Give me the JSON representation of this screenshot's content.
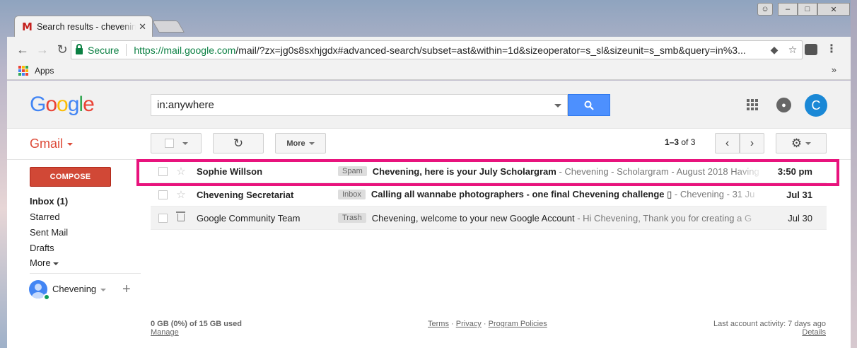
{
  "browser": {
    "tab_title": "Search results - chevening",
    "secure_label": "Secure",
    "url_domain": "https://mail.google.com",
    "url_rest": "/mail/?zx=jg0s8sxhjgdx#advanced-search/subset=ast&within=1d&sizeoperator=s_sl&sizeunit=s_smb&query=in%3...",
    "bookmarks": {
      "apps_label": "Apps",
      "more_glyph": "»"
    }
  },
  "header": {
    "logo_letters": [
      "G",
      "o",
      "o",
      "g",
      "l",
      "e"
    ],
    "search_value": "in:anywhere",
    "avatar_letter": "C",
    "brand_color": "#4285f4"
  },
  "sidebar": {
    "app_label": "Gmail",
    "compose_label": "COMPOSE",
    "items": [
      {
        "label": "Inbox (1)"
      },
      {
        "label": "Starred"
      },
      {
        "label": "Sent Mail"
      },
      {
        "label": "Drafts"
      },
      {
        "label": "More"
      }
    ],
    "account_name": "Chevening",
    "add_glyph": "+"
  },
  "toolbar": {
    "more_label": "More",
    "refresh_glyph": "↻",
    "page_count_range": "1–3",
    "page_count_total": "of 3",
    "prev_glyph": "‹",
    "next_glyph": "›",
    "settings_glyph": "⚙"
  },
  "messages": [
    {
      "sender": "Sophie Willson",
      "label": "Spam",
      "subject": "Chevening, here is your July Scholargram",
      "snippet": " - Chevening - Scholargram - August 2018 Having",
      "date": "3:50 pm",
      "unread": true
    },
    {
      "sender": "Chevening Secretariat",
      "label": "Inbox",
      "subject": "Calling all wannabe photographers - one final Chevening challenge ▯",
      "snippet": " - Chevening - 31 Ju",
      "date": "Jul 31",
      "unread": true
    },
    {
      "sender": "Google Community Team",
      "label": "Trash",
      "subject": "Chevening, welcome to your new Google Account",
      "snippet": " - Hi Chevening, Thank you for creating a G",
      "date": "Jul 30",
      "unread": false
    }
  ],
  "footer": {
    "storage": "0 GB (0%) of 15 GB used",
    "manage": "Manage",
    "terms": "Terms",
    "privacy": "Privacy",
    "program_policies": "Program Policies",
    "separator": "·",
    "last_activity": "Last account activity: 7 days ago",
    "details": "Details"
  },
  "colors": {
    "compose": "#d14836",
    "highlight": "#e8137d",
    "secure": "#0b8043",
    "search_button": "#4d90fe"
  }
}
